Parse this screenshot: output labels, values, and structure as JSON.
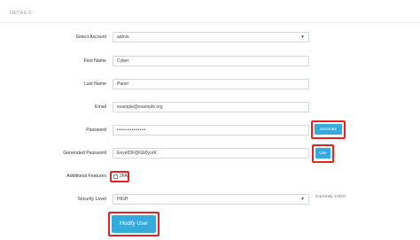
{
  "section": {
    "title": "DETAILS"
  },
  "form": {
    "select_account": {
      "label": "Select Account",
      "value": "admin"
    },
    "first_name": {
      "label": "First Name",
      "value": "Cyber"
    },
    "last_name": {
      "label": "Last Name",
      "value": "Panel"
    },
    "email": {
      "label": "Email",
      "value": "example@example.org"
    },
    "password": {
      "label": "Password",
      "value": "••••••••••••••"
    },
    "generate_button": "Generate",
    "generated_password": {
      "label": "Generated Password",
      "value": "Eeye83F@Gb0yurK"
    },
    "use_button": "Use",
    "additional_features": {
      "label": "Additional Features",
      "checkbox_label": "2FA",
      "checked": false
    },
    "security_level": {
      "label": "Security Level",
      "value": "HIGH",
      "hint": "Currently: HIGH"
    },
    "submit_button": "Modify User"
  },
  "colors": {
    "accent": "#35aadf",
    "highlight": "#e02424"
  }
}
